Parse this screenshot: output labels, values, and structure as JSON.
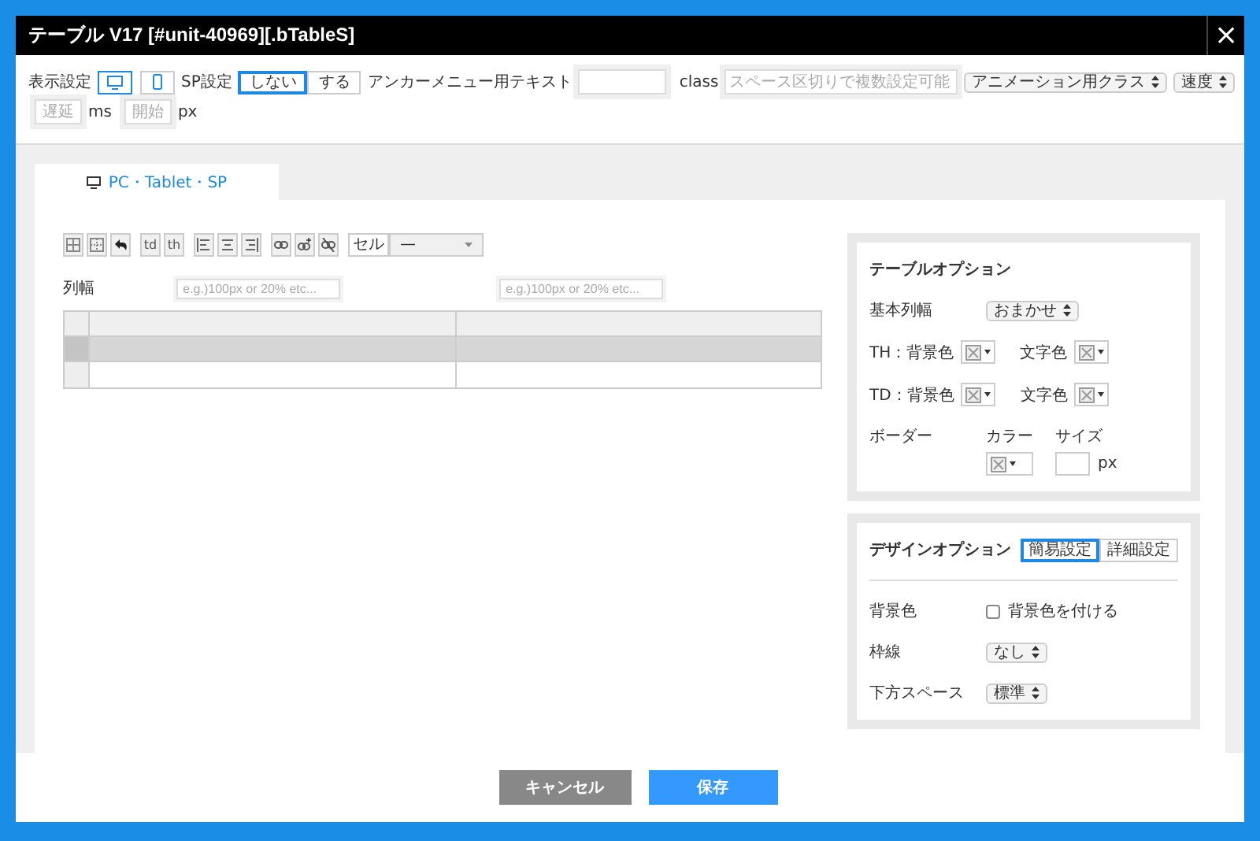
{
  "window": {
    "title": "テーブル V17 [#unit-40969][.bTableS]",
    "close": "×"
  },
  "settings": {
    "display_label": "表示設定",
    "display_options": [
      {
        "kind": "pc",
        "selected": true
      },
      {
        "kind": "sp",
        "selected": false
      }
    ],
    "sp_label": "SP設定",
    "sp_options": [
      {
        "label": "しない",
        "selected": true
      },
      {
        "label": "する",
        "selected": false
      }
    ],
    "anchor_label": "アンカーメニュー用テキスト",
    "class_label": "class",
    "class_placeholder": "スペース区切りで複数設定可能",
    "animation_select": "アニメーション用クラス",
    "speed_select": "速度",
    "delay_placeholder": "遅延",
    "delay_unit": "ms",
    "offset_placeholder": "開始",
    "offset_unit": "px"
  },
  "tabs": [
    {
      "label": "PC・Tablet・SP",
      "selected": true
    }
  ],
  "toolbar": [
    [
      {
        "kind": "icon"
      },
      {
        "kind": "icon"
      },
      {
        "kind": "icon"
      }
    ],
    [
      {
        "kind": "text",
        "label": "td"
      },
      {
        "kind": "text",
        "label": "th"
      }
    ],
    [
      {
        "kind": "icon"
      },
      {
        "kind": "icon"
      },
      {
        "kind": "icon"
      }
    ],
    [
      {
        "kind": "icon"
      },
      {
        "kind": "icon"
      },
      {
        "kind": "icon"
      }
    ]
  ],
  "cell_label": "セル",
  "cell_select": "—",
  "column_width_label": "列幅",
  "column_widths": [
    {
      "placeholder": "e.g.)100px or 20% etc..."
    },
    {
      "placeholder": "e.g.)100px or 20% etc..."
    }
  ],
  "table": {
    "rows": [
      {
        "kind": "header",
        "selected": false
      },
      {
        "kind": "body",
        "selected": true
      },
      {
        "kind": "body",
        "selected": false
      }
    ]
  },
  "table_options": {
    "title": "テーブルオプション",
    "base_width_label": "基本列幅",
    "base_width_select": "おまかせ",
    "color_rows": [
      {
        "label": "TH：背景色",
        "text_color_label": "文字色"
      },
      {
        "label": "TD：背景色",
        "text_color_label": "文字色"
      }
    ],
    "border_label": "ボーダー",
    "border_color_label": "カラー",
    "border_size_label": "サイズ",
    "border_size_unit": "px"
  },
  "design_options": {
    "title": "デザインオプション",
    "modes": [
      {
        "label": "簡易設定",
        "selected": true
      },
      {
        "label": "詳細設定",
        "selected": false
      }
    ],
    "background_label": "背景色",
    "background_checkbox": {
      "label": "背景色を付ける",
      "checked": false
    },
    "frame_label": "枠線",
    "frame_select": "なし",
    "bottom_space_label": "下方スペース",
    "bottom_space_select": "標準"
  },
  "buttons": [
    {
      "kind": "cancel",
      "label": "キャンセル"
    },
    {
      "kind": "save",
      "label": "保存"
    }
  ]
}
